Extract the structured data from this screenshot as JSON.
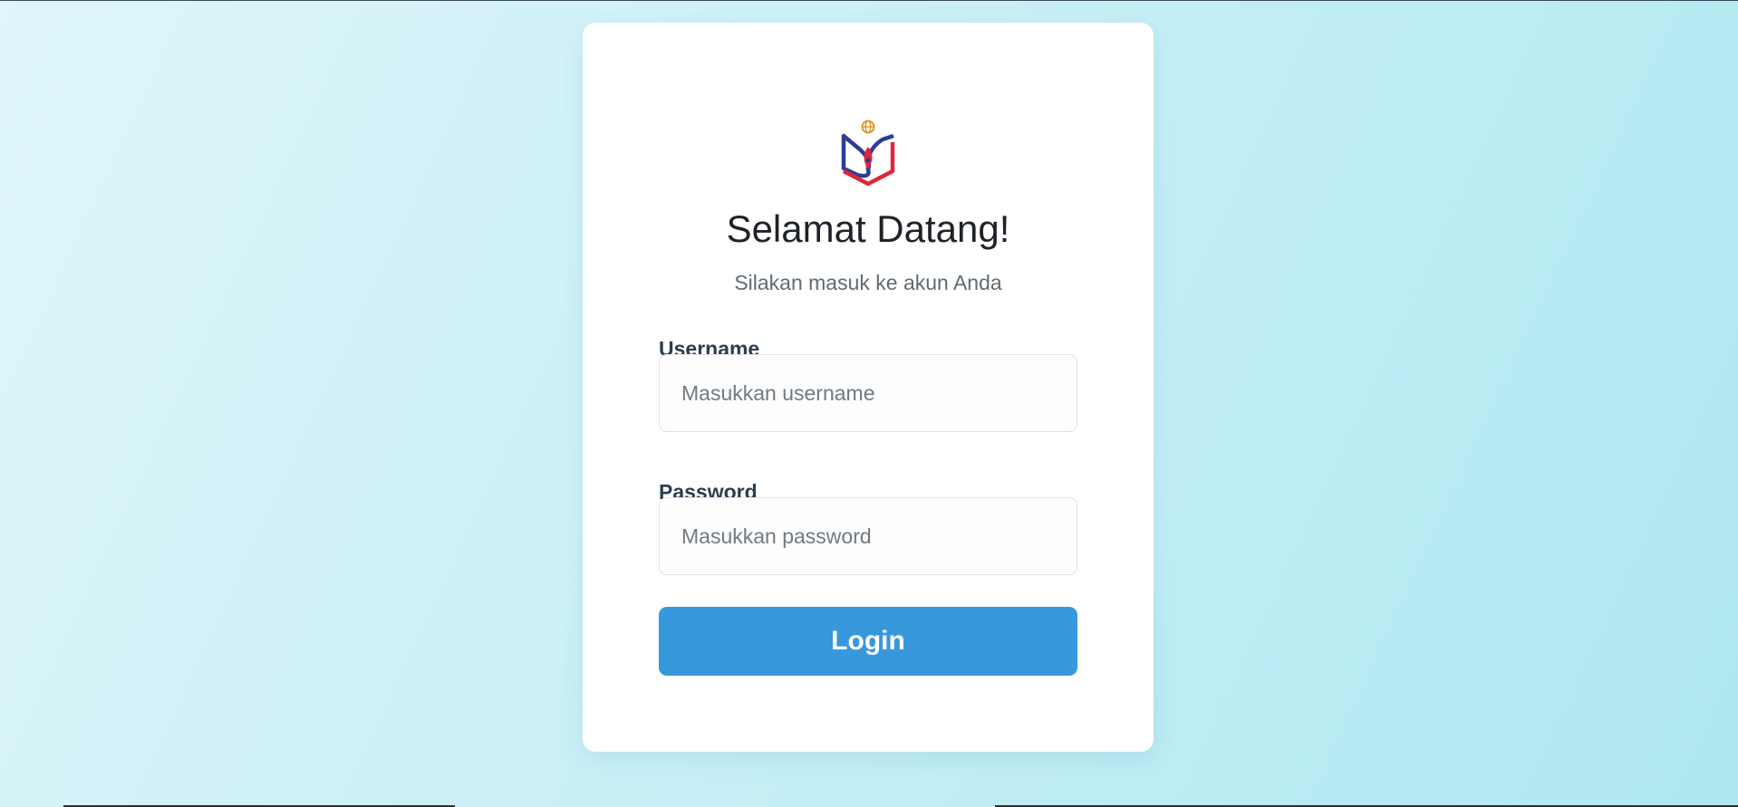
{
  "page": {
    "background_start": "#dff6fa",
    "background_end": "#afe8f1"
  },
  "login_card": {
    "logo": {
      "name": "logo-icon",
      "colors": {
        "blue": "#2d3c9a",
        "red": "#e0263c",
        "gold": "#d99a2b"
      }
    },
    "title": "Selamat Datang!",
    "subtitle": "Silakan masuk ke akun Anda",
    "username": {
      "label": "Username",
      "placeholder": "Masukkan username",
      "value": ""
    },
    "password": {
      "label": "Password",
      "placeholder": "Masukkan password",
      "value": ""
    },
    "login_button": {
      "label": "Login",
      "color": "#3798dc"
    }
  }
}
